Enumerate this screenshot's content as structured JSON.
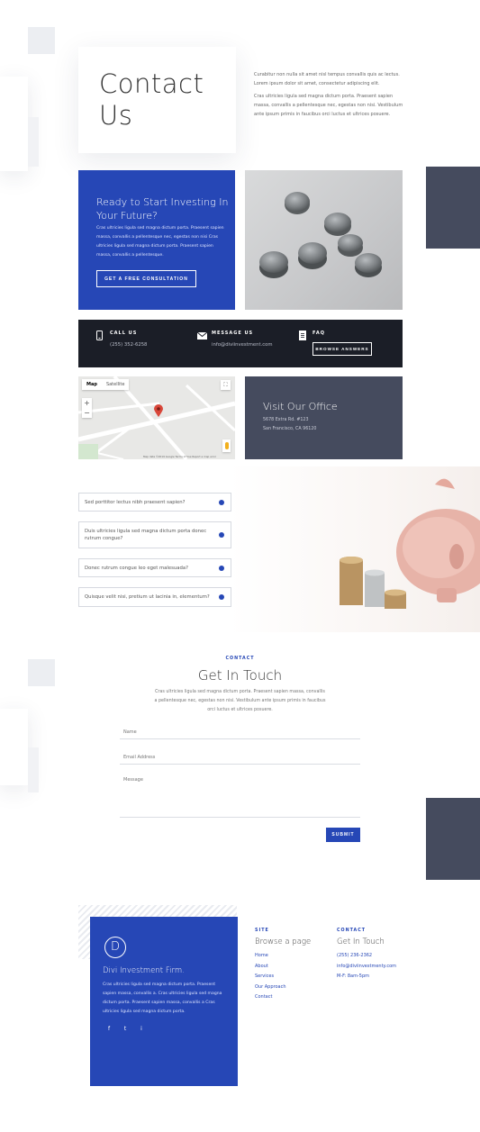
{
  "hero": {
    "title_line1": "Contact",
    "title_line2": "Us",
    "para1": "Curabitur non nulla sit amet nisl tempus convallis quis ac lectus. Lorem ipsum dolor sit amet, consectetur adipiscing elit.",
    "para2": "Cras ultricies ligula sed magna dictum porta. Praesent sapien massa, convallis a pellentesque nec, egestas non nisi. Vestibulum ante ipsum primis in faucibus orci luctus et ultrices posuere."
  },
  "invest": {
    "title": "Ready to Start Investing In Your Future?",
    "text": "Cras ultricies ligula sed magna dictum porta. Praesent sapien massa, convallis a pellentesque nec, egestas non nisi Cras ultricies ligula sed magna dictum porta. Praesent sapien massa, convallis a pellentesque.",
    "button": "GET A FREE CONSULTATION"
  },
  "contact_bar": {
    "call_label": "CALL US",
    "call_value": "(255) 352-6258",
    "message_label": "MESSAGE US",
    "message_value": "info@diviinvestment.com",
    "faq_label": "FAQ",
    "faq_button": "BROWSE ANSWERS"
  },
  "map": {
    "tab_map": "Map",
    "tab_satellite": "Satellite",
    "zoom_in": "+",
    "zoom_out": "−",
    "footer": "Map data ©2019 Google   Terms of Use   Report a map error"
  },
  "office": {
    "title": "Visit Our Office",
    "line1": "5678 Extra Rd. #123",
    "line2": "San Francisco, CA 96120"
  },
  "faq": {
    "items": [
      "Sed porttitor lectus nibh praesent sapien?",
      "Duis ultricies ligula sed magna dictum porta donec rutrum congue?",
      "Donec rutrum congue leo eget malesuada?",
      "Quisque velit nisi, pretium ut lacinia in, elementum?"
    ]
  },
  "get_in_touch": {
    "label": "CONTACT",
    "title": "Get In Touch",
    "text": "Cras ultricies ligula sed magna dictum porta. Praesent sapien massa, convallis a pellentesque nec, egestas non nisi. Vestibulum ante ipsum primis in faucibus orci luctus et ultrices posuere.",
    "name_placeholder": "Name",
    "email_placeholder": "Email Address",
    "message_placeholder": "Message",
    "submit": "SUBMIT"
  },
  "footer": {
    "logo_letter": "D",
    "brand": "Divi Investment Firm.",
    "text": "Cras ultricies ligula sed magna dictum porta. Praesent sapien massa, convallis a. Cras ultricies ligula sed magna dictum porta. Praesent sapien massa, convallis a Cras ultricies ligula sed magna dictum porta.",
    "social": [
      "f",
      "t",
      "i"
    ],
    "site_label": "SITE",
    "site_title": "Browse a page",
    "links": [
      "Home",
      "About",
      "Services",
      "Our Approach",
      "Contact"
    ],
    "contact_label": "CONTACT",
    "contact_title": "Get In Touch",
    "phone": "(255) 236-2362",
    "email": "info@diviinvestmenty.com",
    "hours": "M-F: 8am-5pm"
  },
  "colors": {
    "accent": "#2647b6",
    "dark": "#1b1e27",
    "slate": "#454b5e"
  }
}
